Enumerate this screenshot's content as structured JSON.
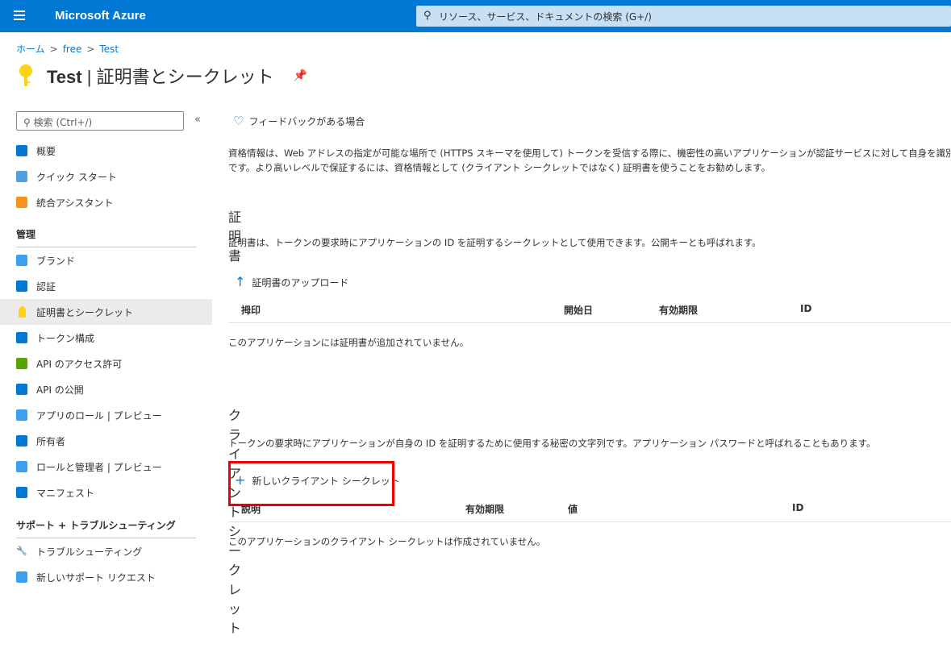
{
  "header": {
    "app_title": "Microsoft Azure",
    "search_placeholder": "リソース、サービス、ドキュメントの検索 (G+/)"
  },
  "breadcrumb": [
    "ホーム",
    "free",
    "Test"
  ],
  "page": {
    "title_resource": "Test",
    "title_sep": " | ",
    "title_page": "証明書とシークレット"
  },
  "sidebar": {
    "search_placeholder": "検索 (Ctrl+/)",
    "collapse": "«",
    "items": [
      {
        "label": "概要",
        "icon": "grid-icon",
        "color": "#0078d4"
      },
      {
        "label": "クイック スタート",
        "icon": "cloud-icon",
        "color": "#50a0e0"
      },
      {
        "label": "統合アシスタント",
        "icon": "rocket-icon",
        "color": "#f7941d"
      }
    ],
    "section_manage": "管理",
    "manage_items": [
      {
        "label": "ブランド",
        "icon": "web-icon",
        "color": "#3aa0f0"
      },
      {
        "label": "認証",
        "icon": "signin-icon",
        "color": "#0078d4"
      },
      {
        "label": "証明書とシークレット",
        "icon": "key-icon",
        "color": "#fcd116"
      },
      {
        "label": "トークン構成",
        "icon": "bars-icon",
        "color": "#0078d4"
      },
      {
        "label": "API のアクセス許可",
        "icon": "api-icon",
        "color": "#57a300"
      },
      {
        "label": "API の公開",
        "icon": "cloud-api-icon",
        "color": "#0078d4"
      },
      {
        "label": "アプリのロール | プレビュー",
        "icon": "users-icon",
        "color": "#3aa0f0"
      },
      {
        "label": "所有者",
        "icon": "owners-icon",
        "color": "#0078d4"
      },
      {
        "label": "ロールと管理者 | プレビュー",
        "icon": "admin-icon",
        "color": "#3aa0f0"
      },
      {
        "label": "マニフェスト",
        "icon": "manifest-icon",
        "color": "#0078d4"
      }
    ],
    "section_support": "サポート + トラブルシューティング",
    "support_items": [
      {
        "label": "トラブルシューティング",
        "icon": "wrench-icon",
        "color": "#323130"
      },
      {
        "label": "新しいサポート リクエスト",
        "icon": "support-icon",
        "color": "#3aa0f0"
      }
    ],
    "selected": "証明書とシークレット"
  },
  "main": {
    "feedback": "フィードバックがある場合",
    "description_1": "資格情報は、Web アドレスの指定が可能な場所で (HTTPS スキーマを使用して) トークンを受信する際に、機密性の高いアプリケーションが認証サービスに対して自身を識別できるよう",
    "description_2": "です。より高いレベルで保証するには、資格情報として (クライアント シークレットではなく) 証明書を使うことをお勧めします。",
    "certs": {
      "heading": "証明書",
      "description": "証明書は、トークンの要求時にアプリケーションの ID を証明するシークレットとして使用できます。公開キーとも呼ばれます。",
      "upload": "証明書のアップロード",
      "columns": [
        "拇印",
        "開始日",
        "有効期限",
        "ID"
      ],
      "empty": "このアプリケーションには証明書が追加されていません。"
    },
    "secrets": {
      "heading": "クライアント シークレット",
      "description": "トークンの要求時にアプリケーションが自身の ID を証明するために使用する秘密の文字列です。アプリケーション パスワードと呼ばれることもあります。",
      "new": "新しいクライアント シークレット",
      "columns": [
        "説明",
        "有効期限",
        "値",
        "ID"
      ],
      "empty": "このアプリケーションのクライアント シークレットは作成されていません。"
    }
  }
}
